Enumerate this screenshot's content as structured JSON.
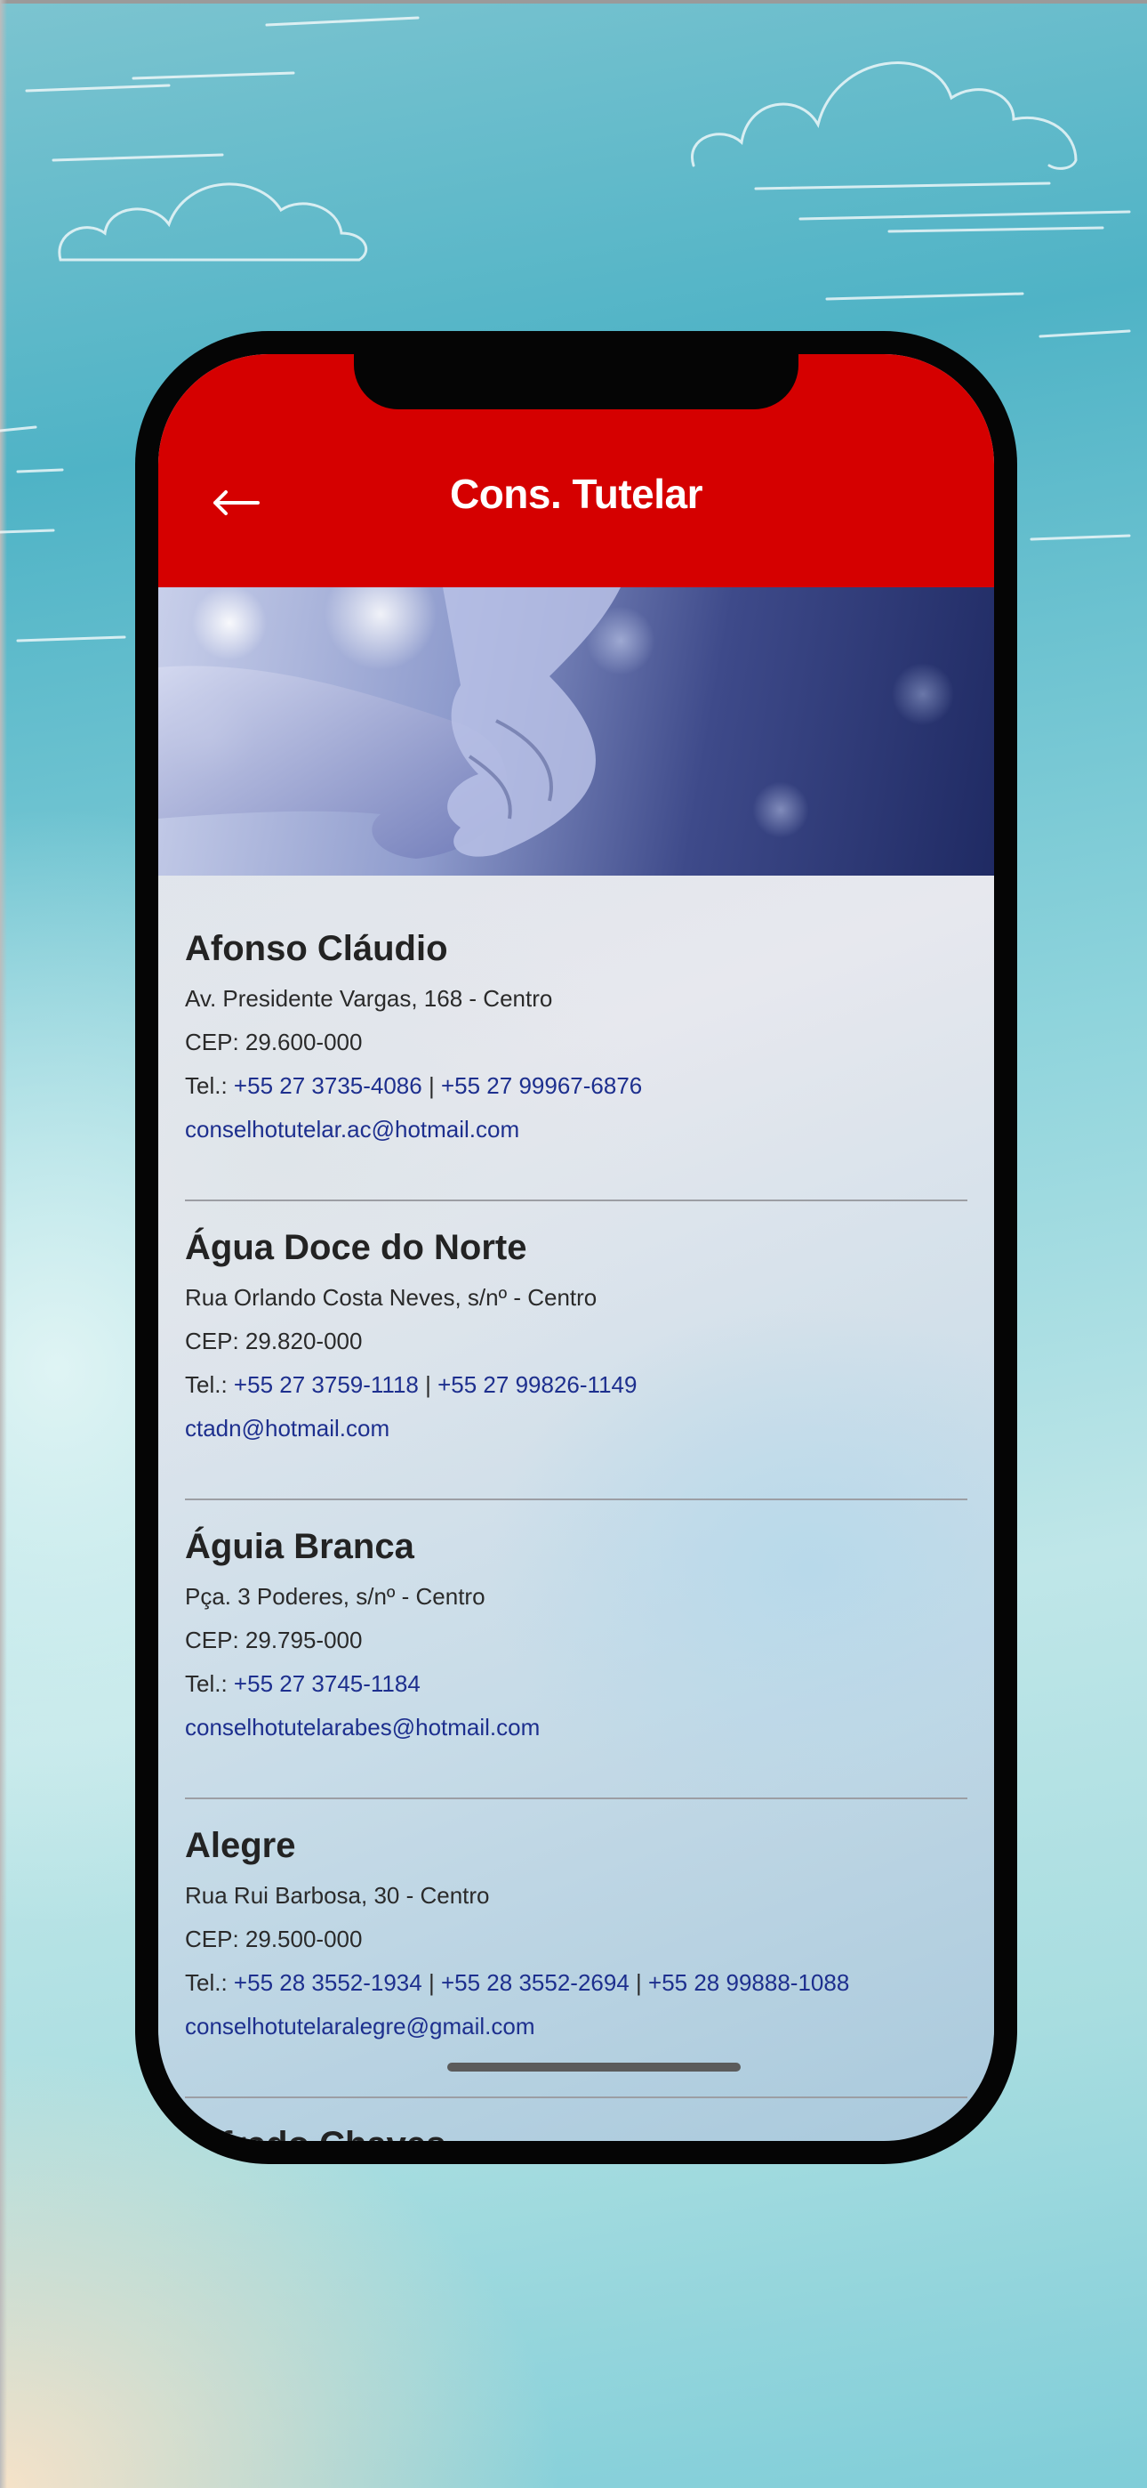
{
  "header": {
    "title": "Cons. Tutelar",
    "back_icon": "arrow-left-icon",
    "color": "#d50000"
  },
  "hero": {
    "image": "hands-holding-photo"
  },
  "entries": [
    {
      "name": "Afonso Cláudio",
      "address": "Av. Presidente Vargas, 168 - Centro",
      "cep": "CEP: 29.600-000",
      "tel_label": "Tel.: ",
      "phones": [
        "+55 27 3735-4086",
        "+55 27 99967-6876"
      ],
      "email": "conselhotutelar.ac@hotmail.com"
    },
    {
      "name": "Água Doce do Norte",
      "address": "Rua Orlando Costa Neves, s/nº - Centro",
      "cep": "CEP: 29.820-000",
      "tel_label": "Tel.: ",
      "phones": [
        "+55 27 3759-1118",
        "+55 27 99826-1149"
      ],
      "email": "ctadn@hotmail.com"
    },
    {
      "name": "Águia Branca",
      "address": "Pça. 3 Poderes, s/nº - Centro",
      "cep": "CEP: 29.795-000",
      "tel_label": "Tel.: ",
      "phones": [
        "+55 27 3745-1184"
      ],
      "email": "conselhotutelarabes@hotmail.com"
    },
    {
      "name": "Alegre",
      "address": "Rua Rui Barbosa, 30 - Centro",
      "cep": "CEP: 29.500-000",
      "tel_label": "Tel.: ",
      "phones": [
        "+55 28 3552-1934",
        "+55 28 3552-2694",
        "+55 28 99888-1088"
      ],
      "email": "conselhotutelaralegre@gmail.com"
    },
    {
      "name": "Alfredo Chaves"
    }
  ],
  "separator": "|"
}
